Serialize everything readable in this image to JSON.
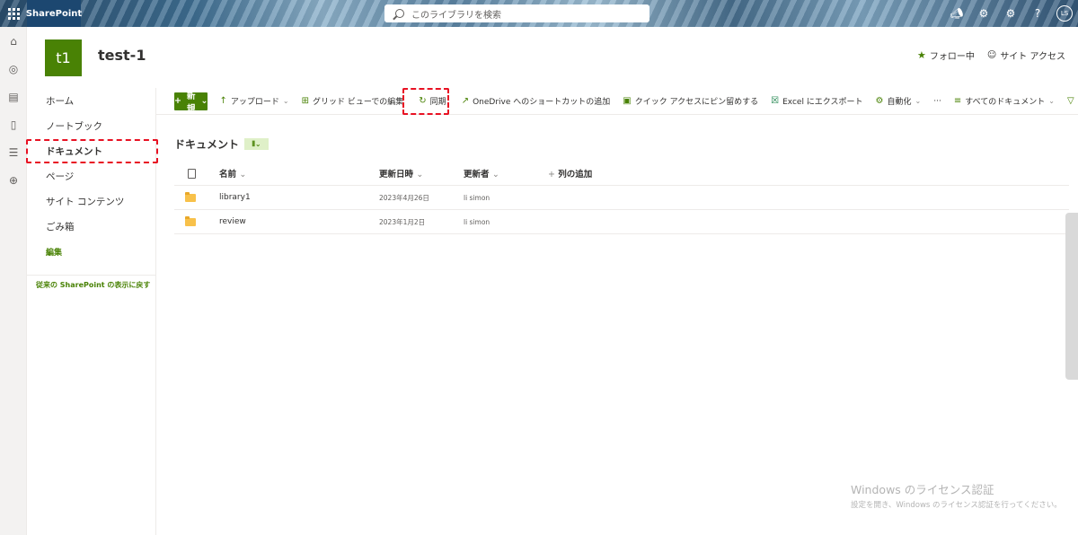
{
  "suitebar": {
    "brand": "SharePoint",
    "search_placeholder": "このライブラリを検索",
    "avatar_initials": "LS",
    "icons": [
      "megaphone-icon",
      "share-icon",
      "gear-icon",
      "help-icon"
    ]
  },
  "rail": {
    "icons": [
      "home-icon",
      "globe-icon",
      "news-icon",
      "file-icon",
      "list-icon",
      "add-circle-icon"
    ]
  },
  "site": {
    "logo": "t1",
    "title": "test-1",
    "follow_label": "フォロー中",
    "access_label": "サイト アクセス"
  },
  "leftnav": {
    "items": [
      "ホーム",
      "ノートブック",
      "ドキュメント",
      "ページ",
      "サイト コンテンツ",
      "ごみ箱"
    ],
    "edit_label": "編集",
    "classic_label": "従来の SharePoint の表示に戻す"
  },
  "commandbar": {
    "new_label": "新規",
    "upload_label": "アップロード",
    "grid_edit_label": "グリッド ビューでの編集",
    "sync_label": "同期",
    "onedrive_shortcut_label": "OneDrive へのショートカットの追加",
    "pin_quick_access_label": "クイック アクセスにピン留めする",
    "excel_export_label": "Excel にエクスポート",
    "automate_label": "自動化",
    "more_label": "···",
    "view_label": "すべてのドキュメント"
  },
  "library": {
    "title": "ドキュメント",
    "columns": {
      "name": "名前",
      "modified": "更新日時",
      "modified_by": "更新者",
      "add_column": "列の追加"
    },
    "rows": [
      {
        "name": "library1",
        "modified": "2023年4月26日",
        "modified_by": "li simon"
      },
      {
        "name": "review",
        "modified": "2023年1月2日",
        "modified_by": "li simon"
      }
    ]
  },
  "watermark": {
    "line1": "Windows のライセンス認証",
    "line2": "設定を開き、Windows のライセンス認証を行ってください。"
  },
  "colors": {
    "accent": "#498205",
    "highlight": "#e81123",
    "suite_brand": "#1c4770"
  }
}
